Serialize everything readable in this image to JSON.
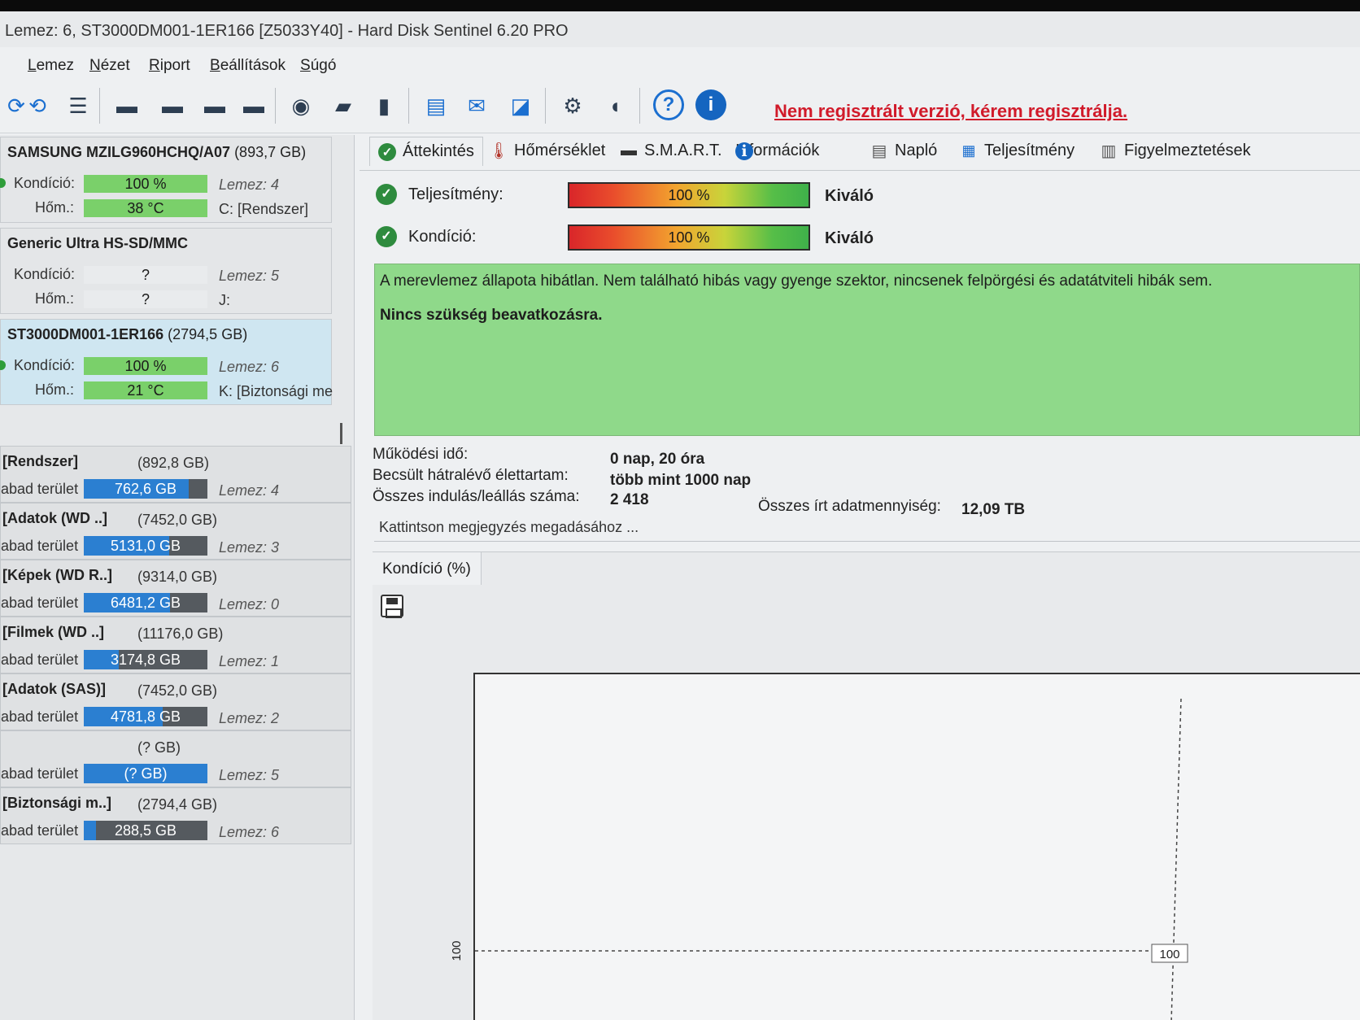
{
  "window": {
    "title": "Lemez: 6, ST3000DM001-1ER166 [Z5033Y40]  -  Hard Disk Sentinel 6.20 PRO"
  },
  "menu": [
    "Lemez",
    "Nézet",
    "Riport",
    "Beállítások",
    "Súgó"
  ],
  "toolbar": {
    "register_link": "Nem regisztrált verzió, kérem regisztrálja."
  },
  "disks": [
    {
      "name": "SAMSUNG MZILG960HCHQ/A07",
      "size": "(893,7 GB)",
      "condition_label": "Kondíció:",
      "condition": "100 %",
      "condition_pct": 100,
      "disk_no": "Lemez: 4",
      "temp_label": "Hőm.:",
      "temp": "38 °C",
      "drive": "C: [Rendszer]"
    },
    {
      "name": "Generic Ultra HS-SD/MMC",
      "size": "",
      "condition_label": "Kondíció:",
      "condition": "?",
      "condition_pct": 0,
      "disk_no": "Lemez: 5",
      "temp_label": "Hőm.:",
      "temp": "?",
      "drive": "J:"
    },
    {
      "name": "ST3000DM001-1ER166",
      "size": "(2794,5 GB)",
      "condition_label": "Kondíció:",
      "condition": "100 %",
      "condition_pct": 100,
      "disk_no": "Lemez: 6",
      "temp_label": "Hőm.:",
      "temp": "21 °C",
      "drive": "K: [Biztonsági me"
    }
  ],
  "partitions_free_label": "abad terület",
  "partitions": [
    {
      "name": "[Rendszer]",
      "size": "(892,8 GB)",
      "free": "762,6 GB",
      "free_fraction": 0.85,
      "disk": "Lemez: 4"
    },
    {
      "name": "[Adatok (WD ..]",
      "size": "(7452,0 GB)",
      "free": "5131,0 GB",
      "free_fraction": 0.69,
      "disk": "Lemez: 3"
    },
    {
      "name": "[Képek (WD R..]",
      "size": "(9314,0 GB)",
      "free": "6481,2 GB",
      "free_fraction": 0.7,
      "disk": "Lemez: 0"
    },
    {
      "name": "[Filmek (WD ..]",
      "size": "(11176,0 GB)",
      "free": "3174,8 GB",
      "free_fraction": 0.28,
      "disk": "Lemez: 1"
    },
    {
      "name": "[Adatok (SAS)]",
      "size": "(7452,0 GB)",
      "free": "4781,8 GB",
      "free_fraction": 0.64,
      "disk": "Lemez: 2"
    },
    {
      "name": "",
      "size": "(? GB)",
      "free": "(? GB)",
      "free_fraction": 1.0,
      "disk": "Lemez: 5"
    },
    {
      "name": "[Biztonsági m..]",
      "size": "(2794,4 GB)",
      "free": "288,5 GB",
      "free_fraction": 0.1,
      "disk": "Lemez: 6"
    }
  ],
  "tabs": [
    "Áttekintés",
    "Hőmérséklet",
    "S.M.A.R.T.",
    "Információk",
    "Napló",
    "Teljesítmény",
    "Figyelmeztetések"
  ],
  "status": {
    "performance_label": "Teljesítmény:",
    "performance_value": "100 %",
    "performance_rating": "Kiváló",
    "condition_label": "Kondíció:",
    "condition_value": "100 %",
    "condition_rating": "Kiváló"
  },
  "message": {
    "line1": "A merevlemez állapota hibátlan. Nem található hibás vagy gyenge szektor, nincsenek felpörgési és adatátviteli hibák sem.",
    "line2": "Nincs szükség beavatkozásra."
  },
  "details": {
    "uptime_label": "Működési idő:",
    "uptime": "0 nap, 20 óra",
    "lifetime_label": "Becsült hátralévő élettartam:",
    "lifetime": "több mint 1000 nap",
    "starts_label": "Összes indulás/leállás száma:",
    "starts": "2 418",
    "written_label": "Összes írt adatmennyiség:",
    "written": "12,09 TB"
  },
  "notes_placeholder": "Kattintson megjegyzés megadásához ...",
  "chart_tab": "Kondíció  (%)",
  "chart_data": {
    "type": "line",
    "title": "Kondíció  (%)",
    "x": [],
    "series": [
      {
        "values": [
          100
        ]
      }
    ],
    "yticks": [
      "100"
    ],
    "point_label": "100",
    "ylim": [
      0,
      100
    ],
    "grid": true
  }
}
